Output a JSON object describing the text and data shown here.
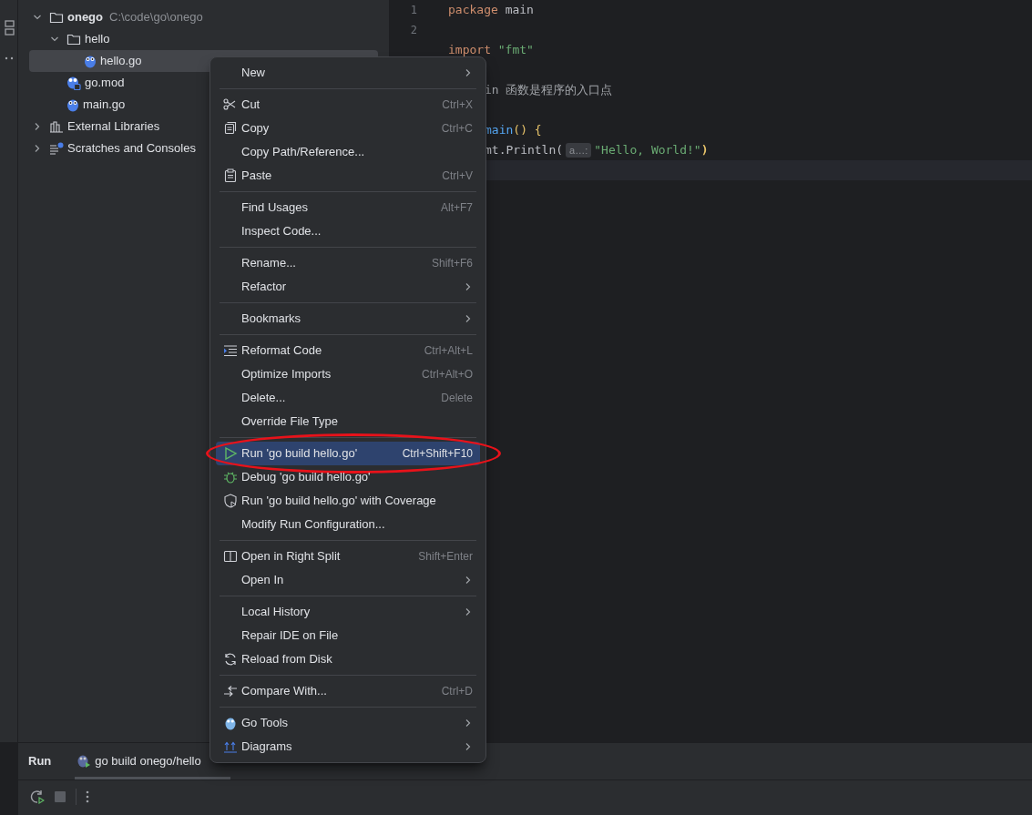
{
  "project_tree": [
    {
      "label": "onego",
      "path": "C:\\code\\go\\onego",
      "kind": "folder",
      "expanded": true,
      "selected": false,
      "children": [
        {
          "label": "hello",
          "kind": "folder",
          "expanded": true,
          "selected": false,
          "children": [
            {
              "label": "hello.go",
              "kind": "gofile",
              "selected": true
            }
          ]
        },
        {
          "label": "go.mod",
          "kind": "gomod",
          "selected": false
        },
        {
          "label": "main.go",
          "kind": "gofile",
          "selected": false
        }
      ]
    },
    {
      "label": "External Libraries",
      "kind": "library",
      "expanded": false,
      "selected": false
    },
    {
      "label": "Scratches and Consoles",
      "kind": "scratches",
      "expanded": false,
      "selected": false
    }
  ],
  "editor": {
    "lines": [
      {
        "number": "1",
        "kind": "full",
        "tokens": [
          {
            "text": "package ",
            "color": "#cf8e6d"
          },
          {
            "text": "main",
            "color": "#bcbec4"
          }
        ]
      },
      {
        "number": "2",
        "kind": "blank"
      },
      {
        "kind": "full",
        "tokens": [
          {
            "text": "import ",
            "color": "#cf8e6d"
          },
          {
            "text": "\"fmt\"",
            "color": "#6aab73"
          }
        ]
      },
      {
        "kind": "blank"
      },
      {
        "kind": "partial",
        "tokens": [
          {
            "text": "in 函数是程序的入口点",
            "color": "#a0a3a8"
          }
        ]
      },
      {
        "kind": "blank"
      },
      {
        "kind": "partial",
        "tokens": [
          {
            "text": "main",
            "color": "#56a8f5"
          },
          {
            "text": "() {",
            "color": "#e8c46a"
          }
        ]
      },
      {
        "kind": "partial",
        "tokens": [
          {
            "text": "mt.Println(",
            "color": "#bcbec4"
          },
          {
            "text": "a…:",
            "kind": "hint"
          },
          {
            "text": "\"Hello, World!\"",
            "color": "#6aab73"
          },
          {
            "text": ")",
            "color": "#e8c46a"
          }
        ]
      },
      {
        "kind": "blank",
        "current": true
      }
    ]
  },
  "context_menu": {
    "groups": [
      [
        {
          "label": "New",
          "submenu": true,
          "selected": false
        }
      ],
      [
        {
          "label": "Cut",
          "shortcut": "Ctrl+X",
          "selected": false
        },
        {
          "label": "Copy",
          "shortcut": "Ctrl+C",
          "selected": false
        },
        {
          "label": "Copy Path/Reference...",
          "selected": false
        },
        {
          "label": "Paste",
          "shortcut": "Ctrl+V",
          "selected": false
        }
      ],
      [
        {
          "label": "Find Usages",
          "shortcut": "Alt+F7",
          "selected": false
        },
        {
          "label": "Inspect Code...",
          "selected": false
        }
      ],
      [
        {
          "label": "Rename...",
          "shortcut": "Shift+F6",
          "selected": false
        },
        {
          "label": "Refactor",
          "submenu": true,
          "selected": false
        }
      ],
      [
        {
          "label": "Bookmarks",
          "submenu": true,
          "selected": false
        }
      ],
      [
        {
          "label": "Reformat Code",
          "shortcut": "Ctrl+Alt+L",
          "selected": false
        },
        {
          "label": "Optimize Imports",
          "shortcut": "Ctrl+Alt+O",
          "selected": false
        },
        {
          "label": "Delete...",
          "shortcut": "Delete",
          "selected": false
        },
        {
          "label": "Override File Type",
          "selected": false
        }
      ],
      [
        {
          "label": "Run 'go build hello.go'",
          "shortcut": "Ctrl+Shift+F10",
          "selected": true
        },
        {
          "label": "Debug 'go build hello.go'",
          "selected": false
        },
        {
          "label": "Run 'go build hello.go' with Coverage",
          "selected": false
        },
        {
          "label": "Modify Run Configuration...",
          "selected": false
        }
      ],
      [
        {
          "label": "Open in Right Split",
          "shortcut": "Shift+Enter",
          "selected": false
        },
        {
          "label": "Open In",
          "submenu": true,
          "selected": false
        }
      ],
      [
        {
          "label": "Local History",
          "submenu": true,
          "selected": false
        },
        {
          "label": "Repair IDE on File",
          "selected": false
        },
        {
          "label": "Reload from Disk",
          "selected": false
        }
      ],
      [
        {
          "label": "Compare With...",
          "shortcut": "Ctrl+D",
          "selected": false
        }
      ],
      [
        {
          "label": "Go Tools",
          "submenu": true,
          "selected": false
        },
        {
          "label": "Diagrams",
          "submenu": true,
          "selected": false
        }
      ]
    ]
  },
  "run_panel": {
    "title": "Run",
    "tabs": [
      {
        "label": "go build onego/hello",
        "selected": true
      }
    ]
  }
}
